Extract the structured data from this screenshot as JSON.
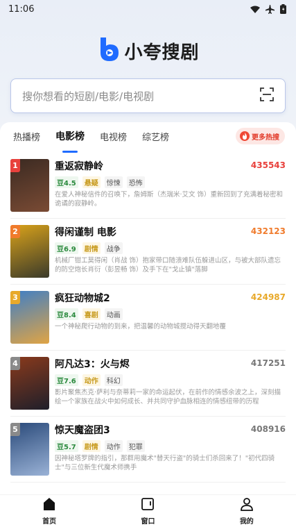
{
  "status": {
    "time": "11:06",
    "icons": [
      "wifi-icon",
      "airplane-icon",
      "battery-icon"
    ]
  },
  "app": {
    "name": "小夸搜剧",
    "accent": "#1f6bff"
  },
  "search": {
    "placeholder": "搜你想看的短剧/电影/电视剧",
    "scan_icon": "scan-icon"
  },
  "tabs": [
    {
      "label": "热播榜",
      "active": false
    },
    {
      "label": "电影榜",
      "active": true
    },
    {
      "label": "电视榜",
      "active": false
    },
    {
      "label": "综艺榜",
      "active": false
    }
  ],
  "hot_button": {
    "label": "更多热搜"
  },
  "items": [
    {
      "rank": "1",
      "rank_color": "#e8413c",
      "title": "重返寂静岭",
      "hot": "435543",
      "hot_color": "#e8413c",
      "score": "豆4.5",
      "genre": "悬疑",
      "tags": [
        "惊悚",
        "恐怖"
      ],
      "desc": "在爱人神秘信件的召唤下，詹姆斯（杰瑞米·艾文 饰）重新回到了充满着秘密和诡谲的寂静岭。",
      "poster_colors": [
        "#3b2a22",
        "#7a4b34"
      ]
    },
    {
      "rank": "2",
      "rank_color": "#f07b2c",
      "title": "得闲谨制 电影",
      "hot": "432123",
      "hot_color": "#f07b2c",
      "score": "豆6.9",
      "genre": "剧情",
      "tags": [
        "战争"
      ],
      "desc": "机械厂钳工莫得闲（肖战 饰）抱家带口随溃难队伍躲进山区，与被大部队遗忘的防空炮长肖衍（彭昱畅 饰）及手下在\"戈止镇\"落脚",
      "poster_colors": [
        "#d9a21a",
        "#3a3a2a"
      ]
    },
    {
      "rank": "3",
      "rank_color": "#e8a92a",
      "title": "疯狂动物城2",
      "hot": "424987",
      "hot_color": "#e8a92a",
      "score": "豆8.4",
      "genre": "喜剧",
      "tags": [
        "动画"
      ],
      "desc": "一个神秘爬行动物的到来，把温馨的动物城搅动得天翻地覆",
      "poster_colors": [
        "#3f7fc6",
        "#e0a444"
      ]
    },
    {
      "rank": "4",
      "rank_color": "#8a8a8a",
      "title": "阿凡达3：火与烬",
      "hot": "417251",
      "hot_color": "#777777",
      "score": "豆7.6",
      "genre": "动作",
      "tags": [
        "科幻"
      ],
      "desc": "影片聚焦杰克·萨利与奈蒂莉一家的命运起伏，在前作的情感余波之上，深刻描绘一个家族在战火中如何成长、并共同守护血脉相连的情感纽带的历程",
      "poster_colors": [
        "#8a3a1c",
        "#1f1f2a"
      ]
    },
    {
      "rank": "5",
      "rank_color": "#8a8a8a",
      "title": "惊天魔盗团3",
      "hot": "408916",
      "hot_color": "#777777",
      "score": "豆5.7",
      "genre": "剧情",
      "tags": [
        "动作",
        "犯罪"
      ],
      "desc": "因神秘塔罗牌的指引，那群用魔术\"替天行盗\"的骑士们杀回来了！\"初代四骑士\"与三位新生代魔术师携手",
      "poster_colors": [
        "#2a4a7a",
        "#9ab2d6"
      ]
    }
  ],
  "bottom_nav": [
    {
      "label": "首页",
      "icon": "home-icon"
    },
    {
      "label": "窗口",
      "icon": "window-icon"
    },
    {
      "label": "我的",
      "icon": "user-icon"
    }
  ]
}
